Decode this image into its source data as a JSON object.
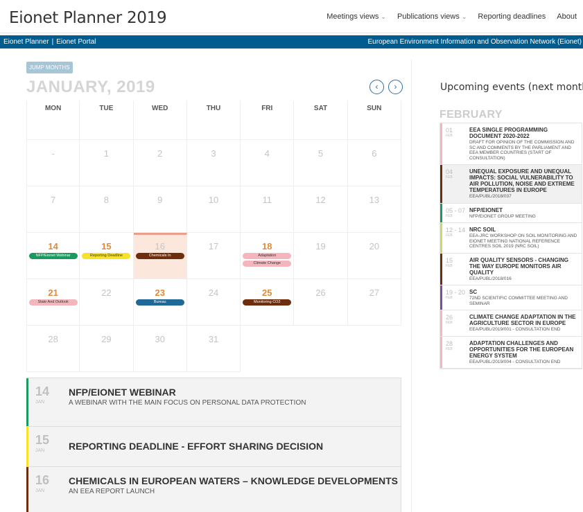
{
  "app": {
    "title": "Eionet Planner 2019"
  },
  "topnav": [
    {
      "label": "Meetings views",
      "dropdown": true
    },
    {
      "label": "Publications views",
      "dropdown": true
    },
    {
      "label": "Reporting deadlines",
      "dropdown": false
    },
    {
      "label": "About",
      "dropdown": false
    }
  ],
  "bluebar": {
    "left_1": "Eionet Planner",
    "sep": "|",
    "left_2": "Eionet Portal",
    "right": "European Environment Information and Observation Network (Eionet)"
  },
  "calendar": {
    "jump_label": "JUMP MONTHS",
    "month_title": "JANUARY, 2019",
    "prev_icon": "chevron-left-icon",
    "next_icon": "chevron-right-icon",
    "weekdays": [
      "MON",
      "TUE",
      "WED",
      "THU",
      "FRI",
      "SAT",
      "SUN"
    ],
    "weeks": [
      [
        {
          "d": "-"
        },
        {
          "d": "1"
        },
        {
          "d": "2"
        },
        {
          "d": "3"
        },
        {
          "d": "4"
        },
        {
          "d": "5"
        },
        {
          "d": "6"
        }
      ],
      [
        {
          "d": "7"
        },
        {
          "d": "8"
        },
        {
          "d": "9"
        },
        {
          "d": "10"
        },
        {
          "d": "11"
        },
        {
          "d": "12"
        },
        {
          "d": "13"
        }
      ],
      [
        {
          "d": "14",
          "strong": true,
          "events": [
            {
              "label": "NFP/Eionet Webinar",
              "color": "green"
            }
          ]
        },
        {
          "d": "15",
          "strong": true,
          "events": [
            {
              "label": "Reporting Deadline",
              "color": "yellow"
            }
          ]
        },
        {
          "d": "16",
          "today": true,
          "events": [
            {
              "label": "Chemicals In",
              "color": "brown"
            }
          ]
        },
        {
          "d": "17"
        },
        {
          "d": "18",
          "strong": true,
          "events": [
            {
              "label": "Adaptation",
              "color": "pink"
            },
            {
              "label": "Climate Change",
              "color": "pink"
            }
          ]
        },
        {
          "d": "19"
        },
        {
          "d": "20"
        }
      ],
      [
        {
          "d": "21",
          "strong": true,
          "events": [
            {
              "label": "State And Outlook",
              "color": "pink"
            }
          ]
        },
        {
          "d": "22"
        },
        {
          "d": "23",
          "strong": true,
          "events": [
            {
              "label": "Bureau",
              "color": "blue"
            }
          ]
        },
        {
          "d": "24"
        },
        {
          "d": "25",
          "strong": true,
          "events": [
            {
              "label": "Monitoring CO2",
              "color": "brown"
            }
          ]
        },
        {
          "d": "26"
        },
        {
          "d": "27"
        }
      ],
      [
        {
          "d": "28"
        },
        {
          "d": "29"
        },
        {
          "d": "30"
        },
        {
          "d": "31"
        },
        {
          "empty": true
        },
        {
          "empty": true
        },
        {
          "empty": true
        }
      ]
    ]
  },
  "list": [
    {
      "day": "14",
      "month": "JAN",
      "title": "NFP/EIONET WEBINAR",
      "subtitle": "A WEBINAR WITH THE MAIN FOCUS ON PERSONAL DATA PROTECTION",
      "color": "#1a9a5e"
    },
    {
      "day": "15",
      "month": "JAN",
      "title": "REPORTING DEADLINE - EFFORT SHARING DECISION",
      "subtitle": "",
      "color": "#f7e12b"
    },
    {
      "day": "16",
      "month": "JAN",
      "title": "CHEMICALS IN EUROPEAN WATERS – KNOWLEDGE DEVELOPMENTS",
      "subtitle": "AN EEA REPORT LAUNCH",
      "color": "#6e2e0e"
    }
  ],
  "side": {
    "title": "Upcoming events (next month)",
    "month": "FEBRUARY",
    "events": [
      {
        "day": "01",
        "month": "FEB",
        "title": "EEA SINGLE PROGRAMMING DOCUMENT 2020-2022",
        "subtitle": "DRAFT FOR OPINION OF THE COMMISSION AND SC AND COMMENTS BY THE PARLIAMENT AND EEA MEMBER COUNTRIES (START OF CONSULTATION)",
        "color": "#f4b6bd",
        "shade": false
      },
      {
        "day": "04",
        "month": "FEB",
        "title": "UNEQUAL EXPOSURE AND UNEQUAL IMPACTS: SOCIAL VULNERABILITY TO AIR POLLUTION, NOISE AND EXTREME TEMPERATURES IN EUROPE",
        "subtitle": "EEA/PUBL/2018/037",
        "color": "#6e2e0e",
        "shade": true
      },
      {
        "day": "05 - 07",
        "month": "FEB",
        "title": "NFP/EIONET",
        "subtitle": "NFP/EIONET GROUP MEETING",
        "color": "#1a9a5e",
        "shade": false
      },
      {
        "day": "12 - 14",
        "month": "FEB",
        "title": "NRC SOIL",
        "subtitle": "EEA-JRC WORKSHOP ON SOIL MONITORING AND EIONET MEETING NATIONAL REFERENCE CENTRES SOIL 2019 (NRC SOIL)",
        "color": "#c9d96a",
        "shade": false
      },
      {
        "day": "15",
        "month": "FEB",
        "title": "AIR QUALITY SENSORS - CHANGING THE WAY EUROPE MONITORS AIR QUALITY",
        "subtitle": "EEA/PUBL/2018/016",
        "color": "#6e2e0e",
        "shade": false
      },
      {
        "day": "19 - 20",
        "month": "FEB",
        "title": "SC",
        "subtitle": "72ND SCIENTIFIC COMMITTEE MEETING AND SEMINAR",
        "color": "#7a4ea0",
        "shade": false
      },
      {
        "day": "26",
        "month": "FEB",
        "title": "CLIMATE CHANGE ADAPTATION IN THE AGRICULTURE SECTOR IN EUROPE",
        "subtitle": "EEA/PUBL/2019/001 - CONSULTATION END",
        "color": "#f4b6bd",
        "shade": false
      },
      {
        "day": "28",
        "month": "FEB",
        "title": "ADAPTATION CHALLENGES AND OPPORTUNITIES FOR THE EUROPEAN ENERGY SYSTEM",
        "subtitle": "EEA/PUBL/2019/004 - CONSULTATION END",
        "color": "#f4b6bd",
        "shade": false
      }
    ]
  }
}
